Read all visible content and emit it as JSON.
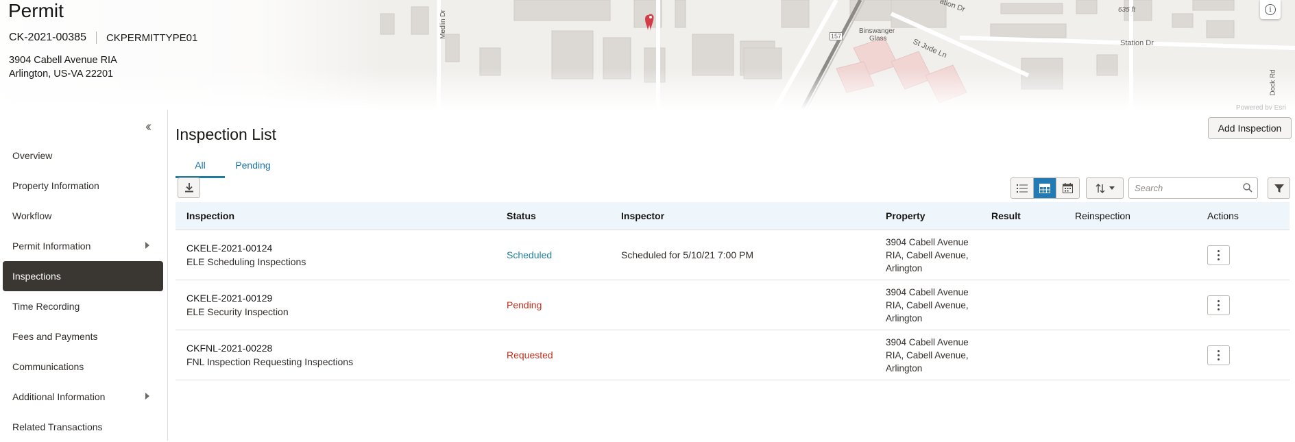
{
  "header": {
    "title": "Permit",
    "permit_number": "CK-2021-00385",
    "permit_type": "CKPERMITTYPE01",
    "address_line1": "3904 Cabell Avenue RIA",
    "address_line2": "Arlington, US-VA 22201",
    "map_labels": {
      "station_dr_top": "ation Dr",
      "station_dr": "Station Dr",
      "st_jude_ln": "St Jude Ln",
      "binswanger": "Binswanger",
      "glass": "Glass",
      "elevation": "635 ft",
      "medlin_dr": "Medlin Dr",
      "route": "157",
      "dock_rd": "Dock Rd",
      "credit": "Powered by Esri"
    }
  },
  "sidebar": {
    "items": [
      {
        "label": "Overview"
      },
      {
        "label": "Property Information"
      },
      {
        "label": "Workflow"
      },
      {
        "label": "Permit Information"
      },
      {
        "label": "Inspections"
      },
      {
        "label": "Time Recording"
      },
      {
        "label": "Fees and Payments"
      },
      {
        "label": "Communications"
      },
      {
        "label": "Additional Information"
      },
      {
        "label": "Related Transactions"
      }
    ]
  },
  "main": {
    "title": "Inspection List",
    "add_button": "Add Inspection",
    "tabs": [
      {
        "label": "All"
      },
      {
        "label": "Pending"
      }
    ],
    "search_placeholder": "Search",
    "columns": {
      "inspection": "Inspection",
      "status": "Status",
      "inspector": "Inspector",
      "property": "Property",
      "result": "Result",
      "reinspection": "Reinspection",
      "actions": "Actions"
    },
    "rows": [
      {
        "id": "CKELE-2021-00124",
        "description": "ELE Scheduling Inspections",
        "status": "Scheduled",
        "inspector": "Scheduled for 5/10/21 7:00 PM",
        "property_line1": "3904 Cabell Avenue",
        "property_line2": "RIA, Cabell Avenue,",
        "property_line3": "Arlington"
      },
      {
        "id": "CKELE-2021-00129",
        "description": "ELE Security Inspection",
        "status": "Pending",
        "inspector": "",
        "property_line1": "3904 Cabell Avenue",
        "property_line2": "RIA, Cabell Avenue,",
        "property_line3": "Arlington"
      },
      {
        "id": "CKFNL-2021-00228",
        "description": "FNL Inspection Requesting Inspections",
        "status": "Requested",
        "inspector": "",
        "property_line1": "3904 Cabell Avenue",
        "property_line2": "RIA, Cabell Avenue,",
        "property_line3": "Arlington"
      }
    ]
  },
  "colors": {
    "accent": "#227e9e",
    "active_nav": "#3a3632",
    "status_scheduled": "#227e9e",
    "status_pending": "#c32f1d",
    "map_pin": "#d43b47"
  }
}
